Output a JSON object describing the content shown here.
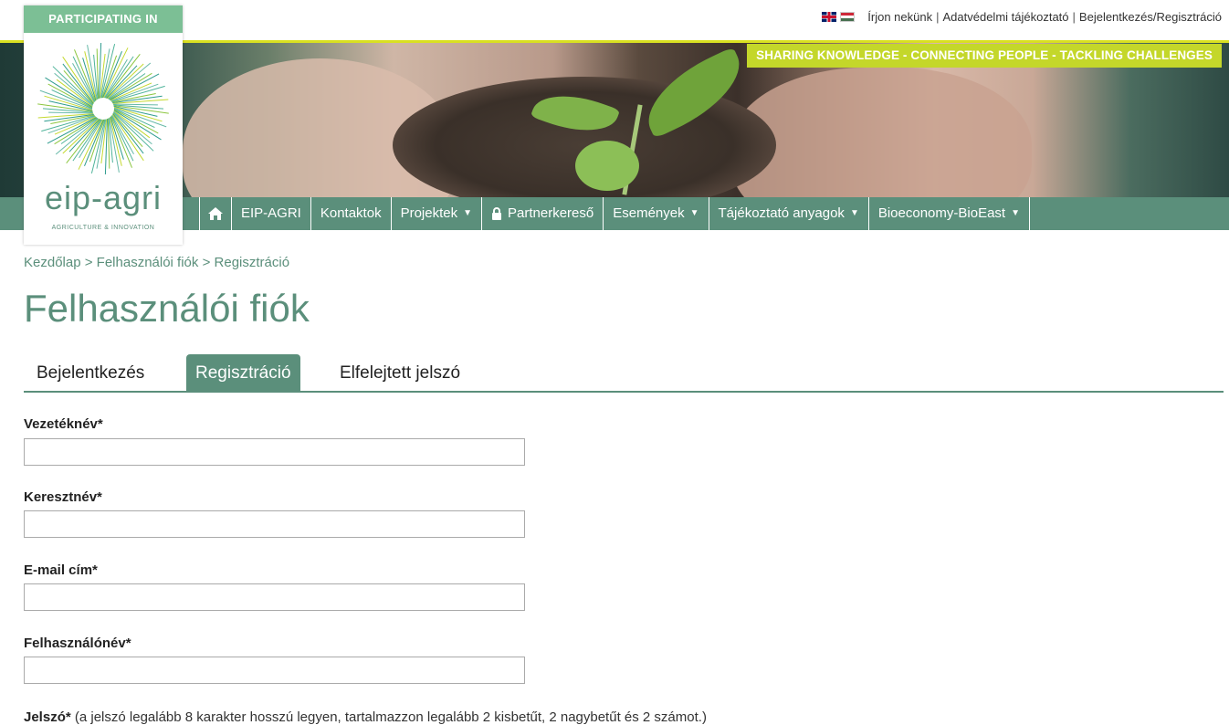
{
  "top": {
    "links": [
      "Írjon nekünk",
      "Adatvédelmi tájékoztató",
      "Bejelentkezés/Regisztráció"
    ],
    "flags": [
      "uk-flag-icon",
      "hu-flag-icon"
    ]
  },
  "hero": {
    "tagline": "SHARING KNOWLEDGE - CONNECTING PEOPLE - TACKLING CHALLENGES"
  },
  "logo": {
    "header": "PARTICIPATING IN",
    "name": "eip-agri",
    "sub": "AGRICULTURE & INNOVATION"
  },
  "nav": {
    "items": [
      {
        "label": "EIP-AGRI",
        "dropdown": false
      },
      {
        "label": "Kontaktok",
        "dropdown": false
      },
      {
        "label": "Projektek",
        "dropdown": true
      },
      {
        "label": "Partnerkereső",
        "dropdown": false,
        "icon": "lock-icon"
      },
      {
        "label": "Események",
        "dropdown": true
      },
      {
        "label": "Tájékoztató anyagok",
        "dropdown": true
      },
      {
        "label": "Bioeconomy-BioEast",
        "dropdown": true
      }
    ]
  },
  "breadcrumb": {
    "items": [
      "Kezdőlap",
      "Felhasználói fiók",
      "Regisztráció"
    ],
    "separator": ">"
  },
  "page": {
    "title": "Felhasználói fiók"
  },
  "tabs": [
    {
      "label": "Bejelentkezés",
      "active": false
    },
    {
      "label": "Regisztráció",
      "active": true
    },
    {
      "label": "Elfelejtett jelszó",
      "active": false
    }
  ],
  "form": {
    "fields": [
      {
        "label": "Vezetéknév*",
        "value": ""
      },
      {
        "label": "Keresztnév*",
        "value": ""
      },
      {
        "label": "E-mail cím*",
        "value": ""
      },
      {
        "label": "Felhasználónév*",
        "value": ""
      }
    ],
    "password_label": "Jelszó*",
    "password_hint": "(a jelszó legalább 8 karakter hosszú legyen, tartalmazzon legalább 2 kisbetűt, 2 nagybetűt és 2 számot.)"
  },
  "colors": {
    "primary": "#5b8f7b",
    "accent": "#c4d72a",
    "logo_header": "#7cbf95"
  }
}
